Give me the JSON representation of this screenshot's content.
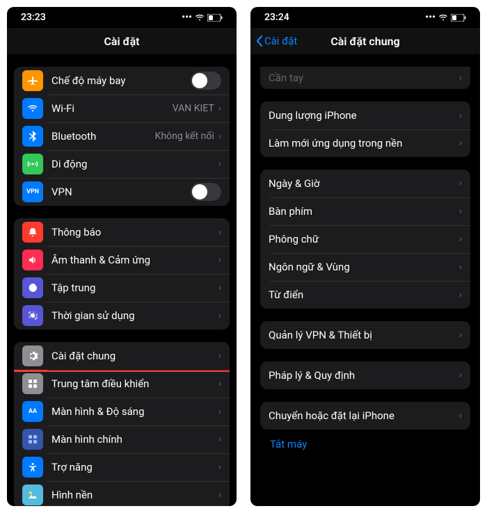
{
  "left": {
    "time": "23:23",
    "title": "Cài đặt",
    "sections": [
      [
        {
          "id": "airplane",
          "label": "Chế độ máy bay",
          "iconBg": "#ff9500",
          "toggle": true
        },
        {
          "id": "wifi",
          "label": "Wi-Fi",
          "iconBg": "#007aff",
          "detail": "VAN KIET"
        },
        {
          "id": "bluetooth",
          "label": "Bluetooth",
          "iconBg": "#007aff",
          "detail": "Không kết nối"
        },
        {
          "id": "cellular",
          "label": "Di động",
          "iconBg": "#34c759"
        },
        {
          "id": "vpn",
          "label": "VPN",
          "iconBg": "#007aff",
          "iconText": "VPN",
          "toggle": true
        }
      ],
      [
        {
          "id": "notifications",
          "label": "Thông báo",
          "iconBg": "#ff3b30"
        },
        {
          "id": "sounds",
          "label": "Âm thanh & Cảm ứng",
          "iconBg": "#ff2d55"
        },
        {
          "id": "focus",
          "label": "Tập trung",
          "iconBg": "#5856d6"
        },
        {
          "id": "screentime",
          "label": "Thời gian sử dụng",
          "iconBg": "#5856d6"
        }
      ],
      [
        {
          "id": "general",
          "label": "Cài đặt chung",
          "iconBg": "#8e8e93",
          "highlighted": true
        },
        {
          "id": "control-center",
          "label": "Trung tâm điều khiển",
          "iconBg": "#8e8e93"
        },
        {
          "id": "display",
          "label": "Màn hình & Độ sáng",
          "iconBg": "#007aff",
          "iconText": "AA"
        },
        {
          "id": "home-screen",
          "label": "Màn hình chính",
          "iconBg": "#3355aa"
        },
        {
          "id": "accessibility",
          "label": "Trợ năng",
          "iconBg": "#007aff"
        },
        {
          "id": "appearance",
          "label": "Hình nền",
          "iconBg": "#55bbdd"
        }
      ]
    ]
  },
  "right": {
    "time": "23:24",
    "back": "Cài đặt",
    "title": "Cài đặt chung",
    "partialTop": {
      "label": "Cần tay"
    },
    "sections": [
      [
        {
          "id": "storage",
          "label": "Dung lượng iPhone"
        },
        {
          "id": "background-refresh",
          "label": "Làm mới ứng dụng trong nền"
        }
      ],
      [
        {
          "id": "date-time",
          "label": "Ngày & Giờ"
        },
        {
          "id": "keyboard",
          "label": "Bàn phím"
        },
        {
          "id": "fonts",
          "label": "Phông chữ"
        },
        {
          "id": "language",
          "label": "Ngôn ngữ & Vùng"
        },
        {
          "id": "dictionary",
          "label": "Từ điển"
        }
      ],
      [
        {
          "id": "vpn-device",
          "label": "Quản lý VPN & Thiết bị"
        }
      ],
      [
        {
          "id": "legal",
          "label": "Pháp lý & Quy định"
        }
      ],
      [
        {
          "id": "transfer-reset",
          "label": "Chuyển hoặc đặt lại iPhone",
          "highlighted": true
        }
      ]
    ],
    "link": "Tắt máy"
  }
}
